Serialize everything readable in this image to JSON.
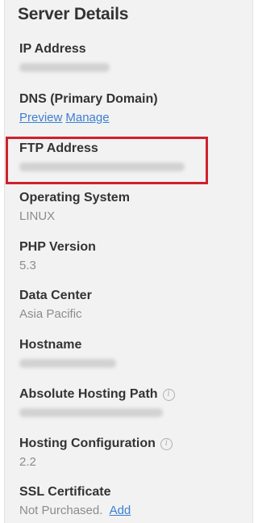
{
  "panel": {
    "title": "Server Details"
  },
  "ip_address": {
    "label": "IP Address"
  },
  "dns": {
    "label": "DNS (Primary Domain)",
    "preview_link": "Preview",
    "manage_link": "Manage"
  },
  "ftp_address": {
    "label": "FTP Address"
  },
  "operating_system": {
    "label": "Operating System",
    "value": "LINUX"
  },
  "php_version": {
    "label": "PHP Version",
    "value": "5.3"
  },
  "data_center": {
    "label": "Data Center",
    "value": "Asia Pacific"
  },
  "hostname": {
    "label": "Hostname"
  },
  "absolute_hosting_path": {
    "label": "Absolute Hosting Path",
    "info_icon": "info-icon"
  },
  "hosting_configuration": {
    "label": "Hosting Configuration",
    "value": "2.2",
    "info_icon": "info-icon"
  },
  "ssl_certificate": {
    "label": "SSL Certificate",
    "value": "Not Purchased.",
    "add_link": "Add"
  },
  "colors": {
    "link": "#3d7fd1",
    "highlight": "#d0212b",
    "label": "#333333",
    "value": "#8c8c8c",
    "panel_bg": "#f2f2f2"
  }
}
